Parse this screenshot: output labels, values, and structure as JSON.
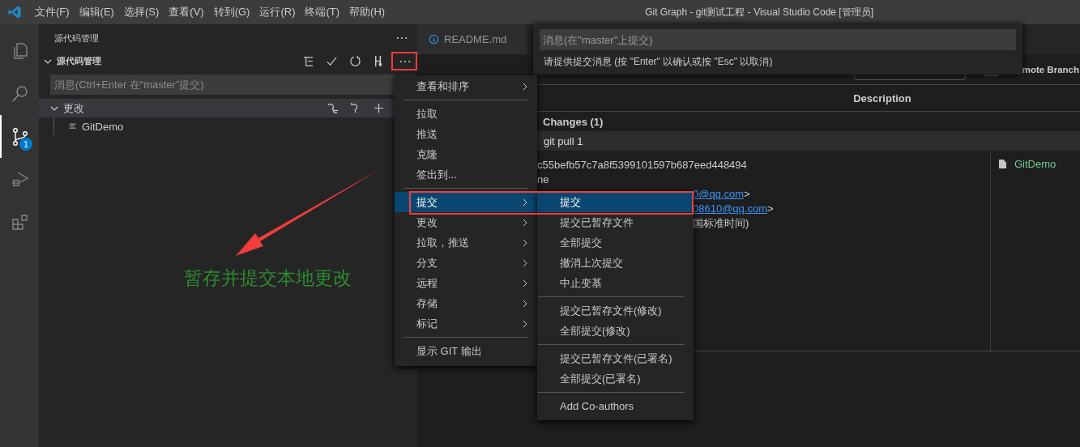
{
  "title_bar": {
    "menus": [
      "文件(F)",
      "编辑(E)",
      "选择(S)",
      "查看(V)",
      "转到(G)",
      "运行(R)",
      "终端(T)",
      "帮助(H)"
    ],
    "title": "Git Graph - git测试工程 - Visual Studio Code [管理员]"
  },
  "activity_bar": [
    {
      "kind": "explorer",
      "selected": false
    },
    {
      "kind": "search",
      "selected": false
    },
    {
      "kind": "scm",
      "selected": true,
      "badge": "1"
    },
    {
      "kind": "debug",
      "selected": false
    },
    {
      "kind": "extensions",
      "selected": false
    }
  ],
  "sidebar": {
    "title": "源代码管理",
    "section": {
      "title": "源代码管理",
      "expanded": true
    },
    "message_placeholder": "消息(Ctrl+Enter 在“master”提交)",
    "changes_group": {
      "label": "更改",
      "expanded": true
    },
    "files": [
      {
        "name": "GitDemo"
      }
    ]
  },
  "tabs": [
    {
      "label": "README.md",
      "selected": false
    }
  ],
  "git_graph": {
    "branch_option": "mote Branch",
    "show_remote_checked": false,
    "column_header": "Description",
    "uncommitted": "Changes (1)",
    "commit_row": "git pull 1",
    "details": {
      "hash": "c55befb57c7a8f5399101597b687eed448494",
      "line_2": "ne",
      "author_email": "0@qq.com",
      "committer_email": "08610@qq.com",
      "email_suffix": ">",
      "date": "国标准时间)"
    },
    "files": [
      {
        "name": "GitDemo"
      }
    ]
  },
  "quick_input": {
    "placeholder": "消息(在\"master\"上提交)",
    "message": "请提供提交消息 (按 \"Enter\" 以确认或按 \"Esc\" 以取消)"
  },
  "context_menu": [
    {
      "kind": "item",
      "label": "查看和排序",
      "submenu": true,
      "selected": false
    },
    {
      "kind": "separator"
    },
    {
      "kind": "item",
      "label": "拉取",
      "submenu": false,
      "selected": false
    },
    {
      "kind": "item",
      "label": "推送",
      "submenu": false,
      "selected": false
    },
    {
      "kind": "item",
      "label": "克隆",
      "submenu": false,
      "selected": false
    },
    {
      "kind": "item",
      "label": "签出到...",
      "submenu": false,
      "selected": false
    },
    {
      "kind": "separator"
    },
    {
      "kind": "item",
      "label": "提交",
      "submenu": true,
      "selected": true
    },
    {
      "kind": "item",
      "label": "更改",
      "submenu": true,
      "selected": false
    },
    {
      "kind": "item",
      "label": "拉取，推送",
      "submenu": true,
      "selected": false
    },
    {
      "kind": "item",
      "label": "分支",
      "submenu": true,
      "selected": false
    },
    {
      "kind": "item",
      "label": "远程",
      "submenu": true,
      "selected": false
    },
    {
      "kind": "item",
      "label": "存储",
      "submenu": true,
      "selected": false
    },
    {
      "kind": "item",
      "label": "标记",
      "submenu": true,
      "selected": false
    },
    {
      "kind": "separator"
    },
    {
      "kind": "item",
      "label": "显示 GIT 输出",
      "submenu": false,
      "selected": false
    }
  ],
  "submenu": [
    {
      "kind": "item",
      "label": "提交",
      "selected": true
    },
    {
      "kind": "item",
      "label": "提交已暂存文件",
      "selected": false
    },
    {
      "kind": "item",
      "label": "全部提交",
      "selected": false
    },
    {
      "kind": "item",
      "label": "撤消上次提交",
      "selected": false
    },
    {
      "kind": "item",
      "label": "中止变基",
      "selected": false
    },
    {
      "kind": "separator"
    },
    {
      "kind": "item",
      "label": "提交已暂存文件(修改)",
      "selected": false
    },
    {
      "kind": "item",
      "label": "全部提交(修改)",
      "selected": false
    },
    {
      "kind": "separator"
    },
    {
      "kind": "item",
      "label": "提交已暂存文件(已署名)",
      "selected": false
    },
    {
      "kind": "item",
      "label": "全部提交(已署名)",
      "selected": false
    },
    {
      "kind": "separator"
    },
    {
      "kind": "item",
      "label": "Add Co-authors",
      "selected": false
    }
  ],
  "annotation": {
    "text": "暂存并提交本地更改"
  }
}
